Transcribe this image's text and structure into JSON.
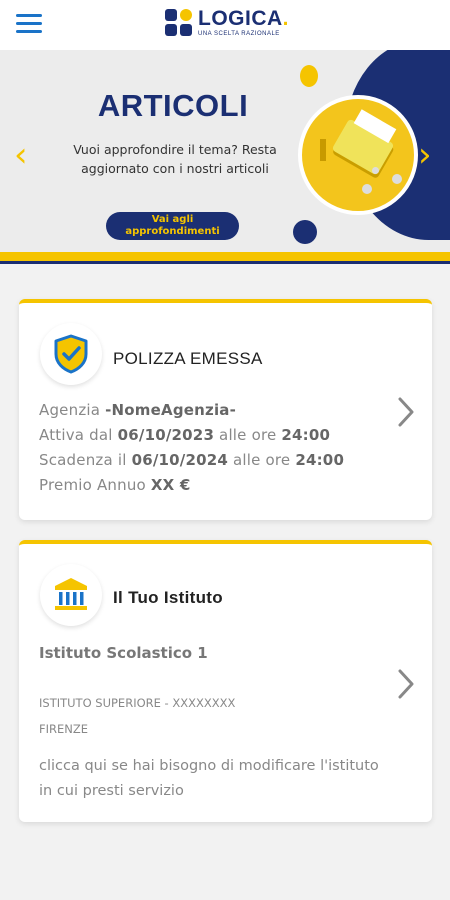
{
  "header": {
    "logo_name": "LOGICA",
    "logo_tagline": "UNA SCELTA RAZIONALE"
  },
  "banner": {
    "title": "ARTICOLI",
    "text": "Vuoi approfondire il tema? Resta aggiornato con i nostri articoli",
    "button_label": "Vai agli approfondimenti"
  },
  "policy_card": {
    "title": "POLIZZA EMESSA",
    "agency_label": "Agenzia",
    "agency_value": "-NomeAgenzia-",
    "active_label": "Attiva dal",
    "active_date": "06/10/2023",
    "time_label": "alle ore",
    "active_time": "24:00",
    "expiry_label": "Scadenza il",
    "expiry_date": "06/10/2024",
    "expiry_time": "24:00",
    "premium_label": "Premio Annuo",
    "premium_value": "XX €"
  },
  "institute_card": {
    "title": "Il Tuo Istituto",
    "name": "Istituto Scolastico 1",
    "type": "ISTITUTO SUPERIORE - XXXXXXXX",
    "city": "FIRENZE",
    "help_text": "clicca qui se hai bisogno di modificare l'istituto in cui presti servizio"
  },
  "colors": {
    "brand_blue": "#1b2f73",
    "brand_yellow": "#f5c400",
    "menu_blue": "#1a73c8"
  }
}
